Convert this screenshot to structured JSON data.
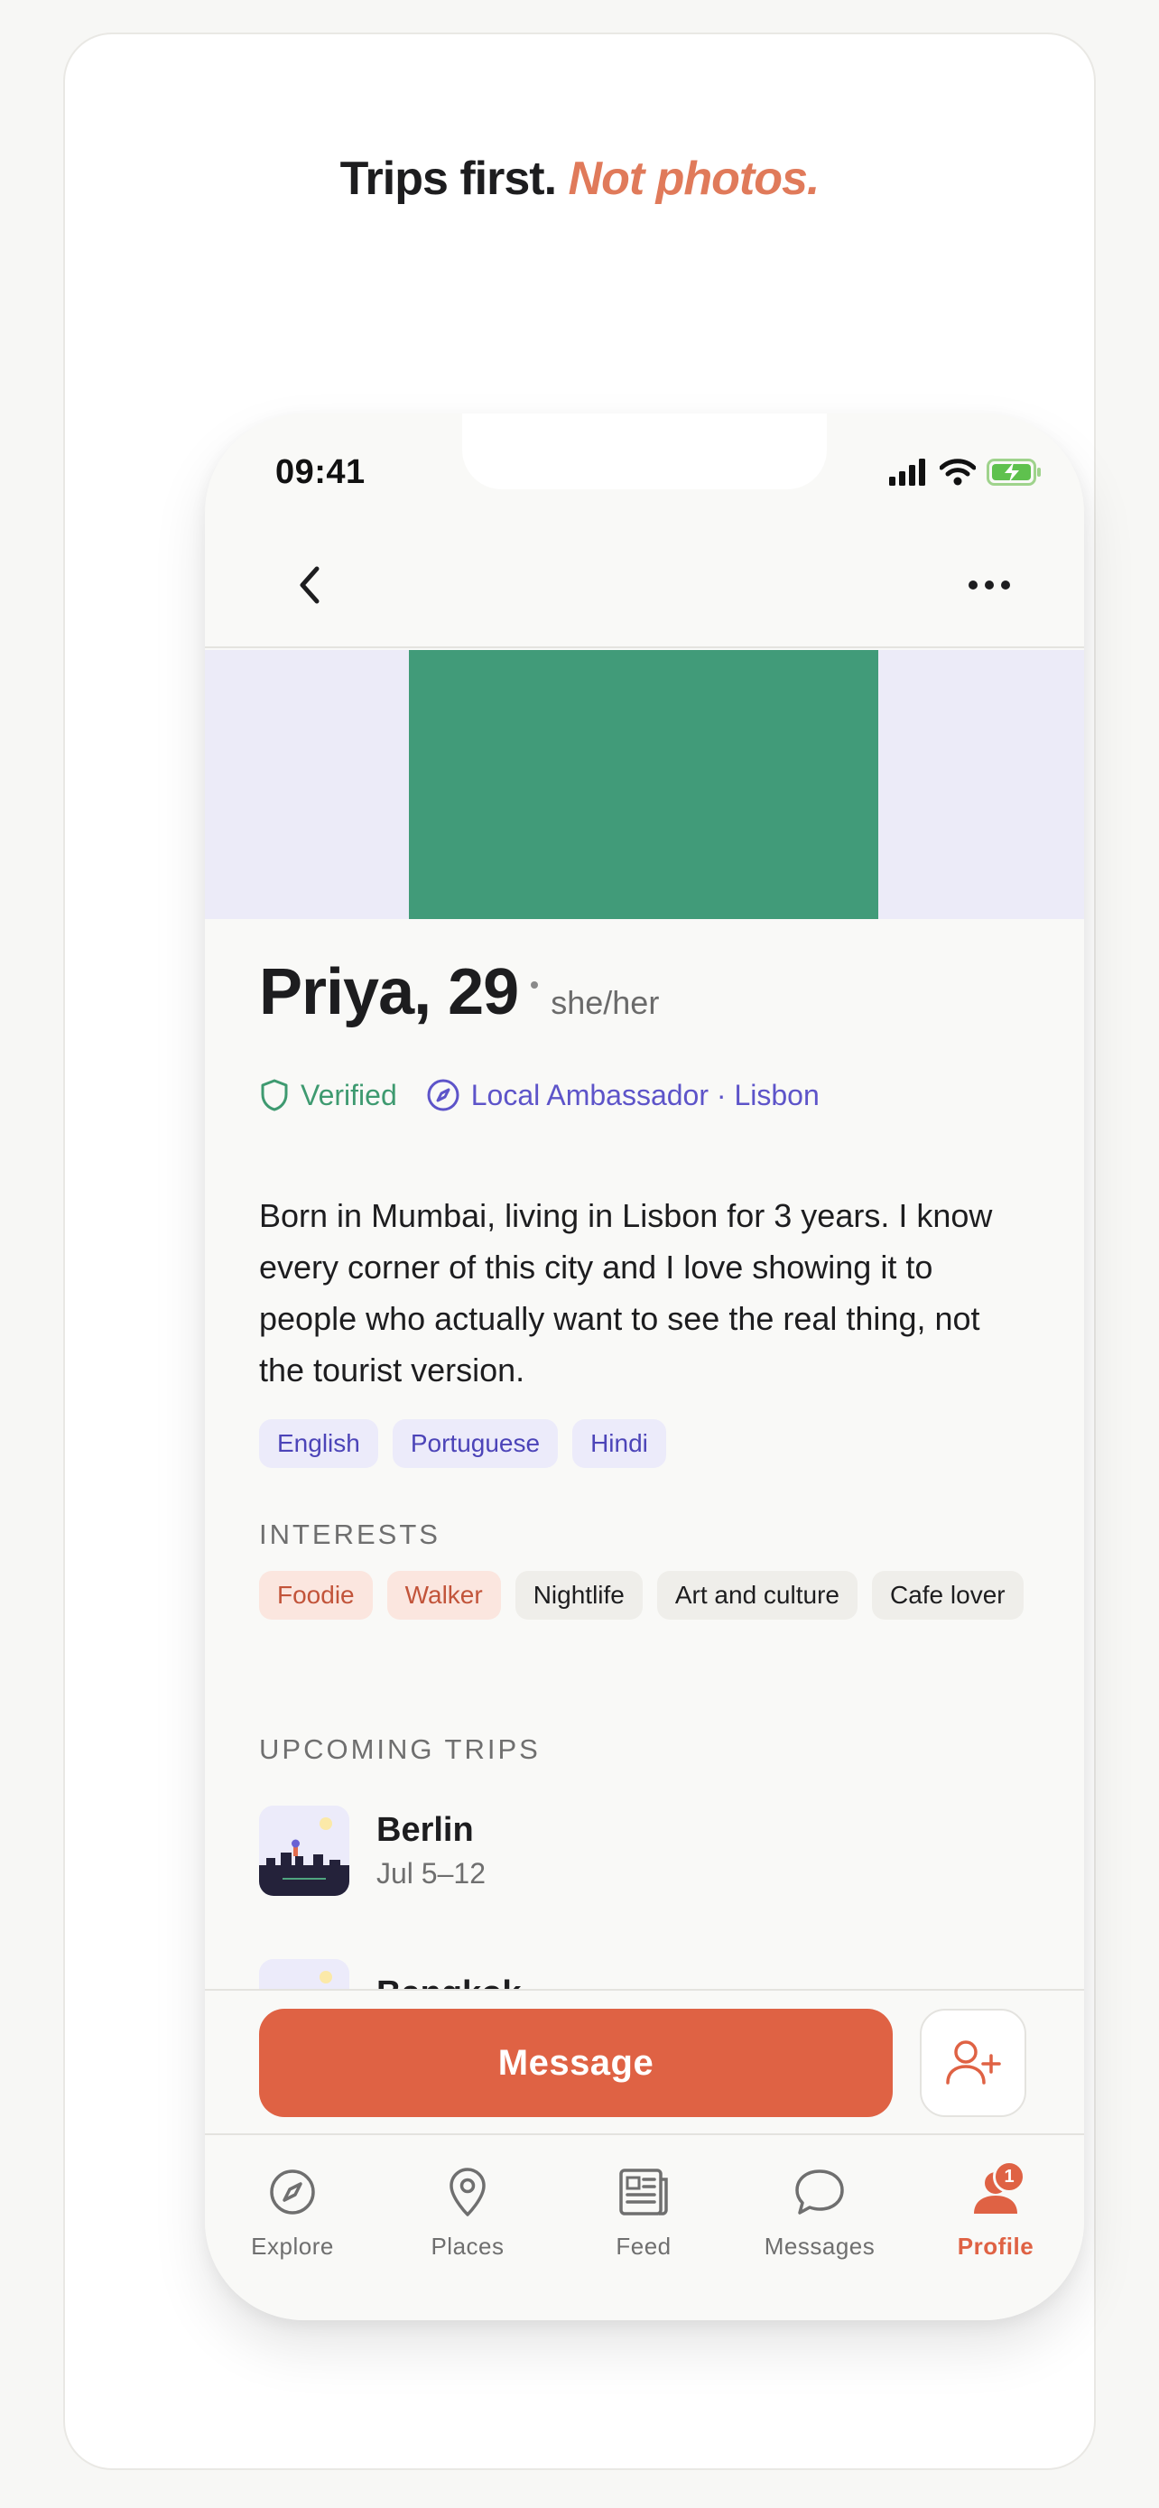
{
  "headline": {
    "part1": "Trips first.",
    "part2": "Not photos."
  },
  "status": {
    "time": "09:41"
  },
  "profile": {
    "name_age": "Priya, 29",
    "pronouns": "she/her",
    "verified_label": "Verified",
    "ambassador_label": "Local Ambassador · Lisbon",
    "bio": "Born in Mumbai, living in Lisbon for 3 years. I know every corner of this city and I love showing it to people who actually want to see the real thing, not the tourist version.",
    "languages": [
      "English",
      "Portuguese",
      "Hindi"
    ]
  },
  "interests": {
    "title": "INTERESTS",
    "items": [
      "Foodie",
      "Walker",
      "Nightlife",
      "Art and culture",
      "Cafe lover"
    ]
  },
  "trips": {
    "title": "UPCOMING TRIPS",
    "items": [
      {
        "city": "Berlin",
        "dates": "Jul 5–12"
      },
      {
        "city": "Bangkok",
        "dates": ""
      }
    ]
  },
  "actions": {
    "message_label": "Message"
  },
  "tabs": [
    {
      "label": "Explore",
      "icon": "compass-icon"
    },
    {
      "label": "Places",
      "icon": "map-pin-icon"
    },
    {
      "label": "Feed",
      "icon": "newspaper-icon"
    },
    {
      "label": "Messages",
      "icon": "chat-bubble-icon"
    },
    {
      "label": "Profile",
      "icon": "person-icon",
      "badge": "1",
      "active": true
    }
  ],
  "colors": {
    "accent": "#df6244",
    "verified": "#3e9a70",
    "ambassador": "#5d54c9",
    "banner_block": "#419b79"
  }
}
